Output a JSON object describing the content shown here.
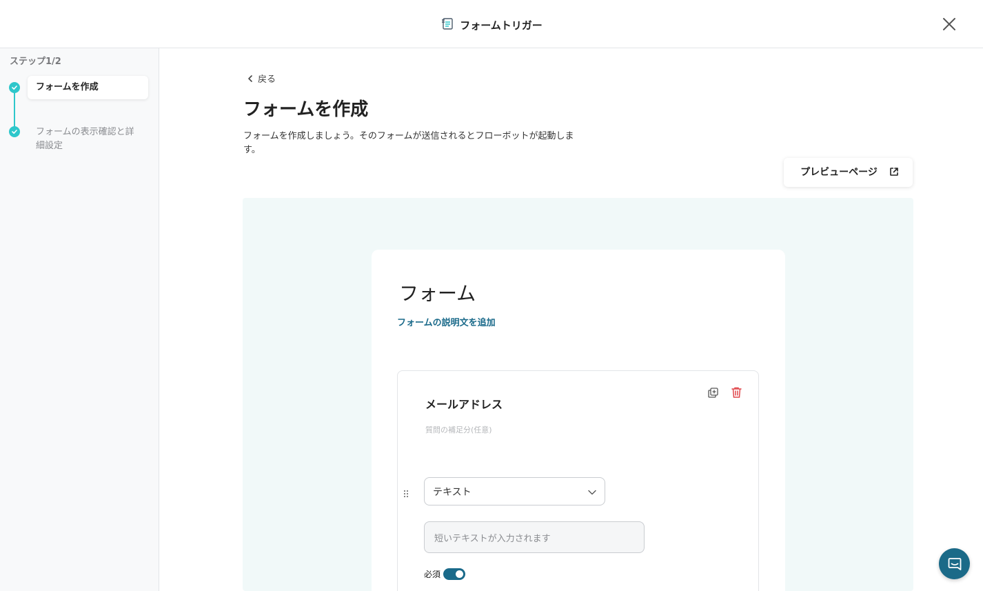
{
  "header": {
    "title": "フォームトリガー",
    "icon": "form-doc-icon",
    "close_icon": "close-icon"
  },
  "sidebar": {
    "step_count": "ステップ1/2",
    "steps": [
      {
        "label": "フォームを作成",
        "status": "complete",
        "active": true
      },
      {
        "label": "フォームの表示確認と詳細設定",
        "status": "complete",
        "active": false
      }
    ]
  },
  "main": {
    "back_label": "戻る",
    "title": "フォームを作成",
    "description": "フォームを作成しましょう。そのフォームが送信されるとフローボットが起動します。",
    "preview_button": "プレビューページ"
  },
  "form": {
    "title": "フォーム",
    "add_description": "フォームの説明文を追加",
    "questions": [
      {
        "title": "メールアドレス",
        "supplement_placeholder": "質問の補足分(任意)",
        "type": "テキスト",
        "answer_placeholder": "短いテキストが入力されます",
        "required_label": "必須",
        "required": true
      }
    ]
  },
  "colors": {
    "accent": "#2ec7cb",
    "link": "#1a6a8a",
    "delete": "#e0464a",
    "canvas_bg": "#f1f9f9",
    "chat_button": "#1b6a88"
  }
}
